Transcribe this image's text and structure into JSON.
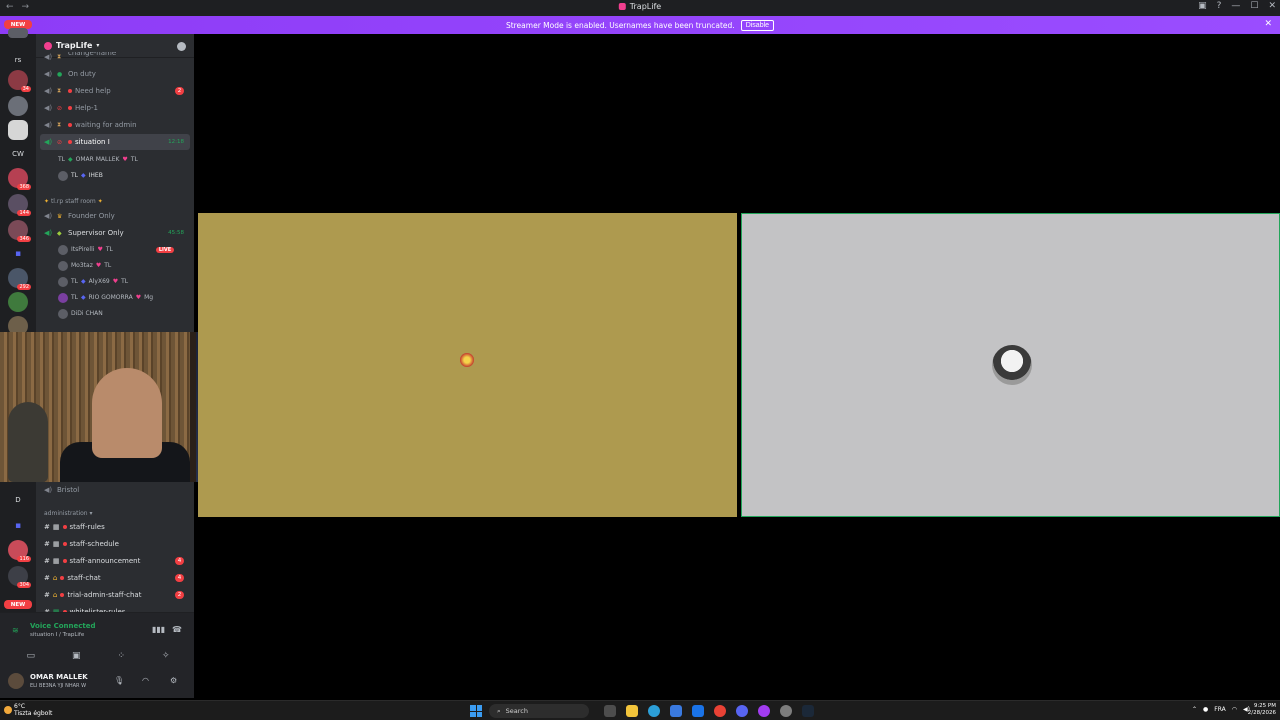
{
  "window": {
    "title": "TrapLife"
  },
  "banner": {
    "message": "Streamer Mode is enabled. Usernames have been truncated.",
    "disable_label": "Disable"
  },
  "rail": {
    "new_label": "NEW",
    "abbr_rs": "rs",
    "abbr_cw": "CW",
    "abbr_d": "D",
    "badges": [
      "34",
      "368",
      "144",
      "346",
      "292",
      "116",
      "304"
    ]
  },
  "guild": {
    "name": "TrapLife",
    "cut_channel": "change-name",
    "voice_channels": [
      {
        "name": "On duty"
      },
      {
        "name": "Need help",
        "badge": "2"
      },
      {
        "name": "Help-1"
      },
      {
        "name": "waiting for admin"
      },
      {
        "name": "situation I",
        "timer": "12:18"
      }
    ],
    "situation_users": [
      {
        "tag": "TL",
        "name": "OMAR MALLEK",
        "suffix": "TL"
      },
      {
        "tag": "TL",
        "name": "IHEB"
      }
    ],
    "staff_category": "tl.rp staff room",
    "staff_channels": [
      {
        "name": "Founder Only"
      },
      {
        "name": "Supervisor Only",
        "timer": "45:58"
      }
    ],
    "supervisor_users": [
      {
        "name": "ItsPirelli",
        "suffix": "TL",
        "live": "LIVE"
      },
      {
        "name": "Mo3taz",
        "suffix": "TL"
      },
      {
        "tag": "TL",
        "name": "AlyX69",
        "suffix": "TL"
      },
      {
        "tag": "TL",
        "name": "RIO GOMORRA",
        "suffix": "Mg"
      },
      {
        "name": "DiDi CHAN"
      }
    ],
    "bristol": "Bristol",
    "admin_category": "administration",
    "text_channels": [
      {
        "name": "staff-rules"
      },
      {
        "name": "staff-schedule"
      },
      {
        "name": "staff-announcement",
        "badge": "4"
      },
      {
        "name": "staff-chat",
        "badge": "4"
      },
      {
        "name": "trial-admin-staff-chat",
        "badge": "2"
      },
      {
        "name": "whitelister-rules"
      }
    ]
  },
  "voice_panel": {
    "status": "Voice Connected",
    "channel": "situation I / TrapLife",
    "user_name": "OMAR MALLEK",
    "user_status": "ELI BE3NA YJI NHAR W"
  },
  "taskbar": {
    "temp": "6°C",
    "weather": "Túlnyomó felhős",
    "weather_short": "Tiszta égbolt",
    "search": "Search",
    "lang": "FRA",
    "time": "9:25 PM",
    "date": "2/28/2026"
  },
  "colors": {
    "accent": "#9146ff",
    "tile1_bg": "#ae9a4f",
    "tile2_bg": "#c3c3c5",
    "speaking": "#23a55a"
  }
}
